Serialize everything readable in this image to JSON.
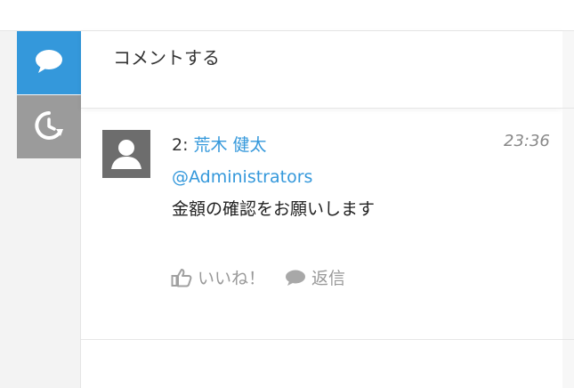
{
  "comment_form": {
    "placeholder": "コメントする"
  },
  "sidebar": {
    "tabs": [
      {
        "name": "comments",
        "icon": "speech-bubble-icon",
        "color": "#3498db"
      },
      {
        "name": "history",
        "icon": "history-clock-icon",
        "color": "#9b9b9b"
      }
    ]
  },
  "comment": {
    "number": "2:",
    "author": "荒木 健太",
    "time": "23:36",
    "mention": "@Administrators",
    "text": "金額の確認をお願いします",
    "like_label": "いいね！",
    "reply_label": "返信",
    "avatar_icon": "default-user-icon"
  },
  "colors": {
    "accent": "#3498db",
    "link": "#3498db",
    "muted": "#999999"
  }
}
